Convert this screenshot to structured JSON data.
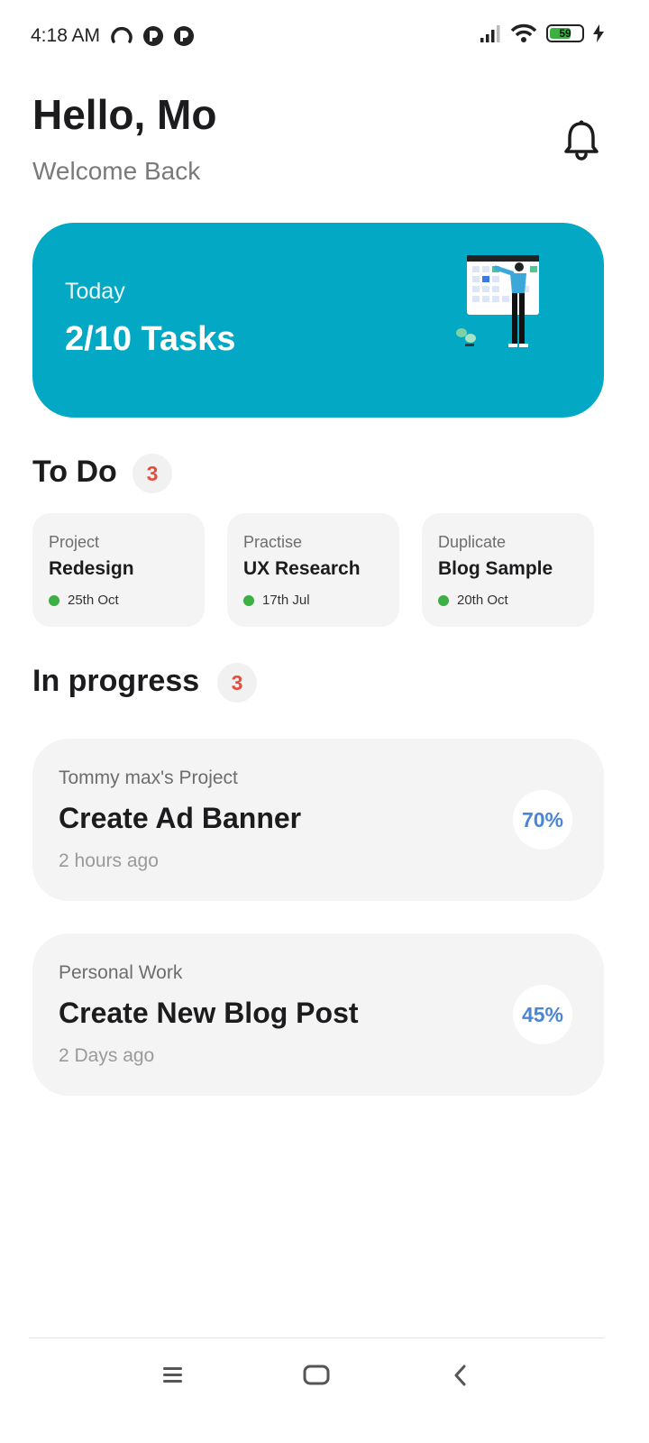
{
  "status_bar": {
    "time": "4:18 AM",
    "battery_level": "59",
    "icons": [
      "loading-icon",
      "app-notification-icon",
      "app-notification-icon",
      "signal-icon",
      "wifi-icon",
      "battery-icon",
      "charging-icon"
    ]
  },
  "header": {
    "greeting": "Hello, Mo",
    "subtitle": "Welcome Back",
    "notification_icon": "bell-icon"
  },
  "today_card": {
    "label": "Today",
    "value": "2/10 Tasks",
    "illustration": "person-calendar-illustration",
    "color": "#03a9c4"
  },
  "todo": {
    "title": "To Do",
    "count": "3",
    "items": [
      {
        "category": "Project",
        "title": "Redesign",
        "date": "25th Oct"
      },
      {
        "category": "Practise",
        "title": "UX Research",
        "date": "17th Jul"
      },
      {
        "category": "Duplicate",
        "title": "Blog Sample",
        "date": "20th Oct"
      }
    ]
  },
  "in_progress": {
    "title": "In progress",
    "count": "3",
    "items": [
      {
        "project": "Tommy max's Project",
        "title": "Create Ad Banner",
        "time": "2 hours ago",
        "progress": "70%"
      },
      {
        "project": "Personal Work",
        "title": "Create New Blog Post",
        "time": "2 Days ago",
        "progress": "45%"
      }
    ]
  },
  "nav_bar": {
    "buttons": [
      "menu-icon",
      "home-icon",
      "back-icon"
    ]
  },
  "colors": {
    "accent": "#03a9c4",
    "badge_text": "#e74c3c",
    "progress_text": "#4a86d4",
    "status_green": "#3cb043"
  }
}
